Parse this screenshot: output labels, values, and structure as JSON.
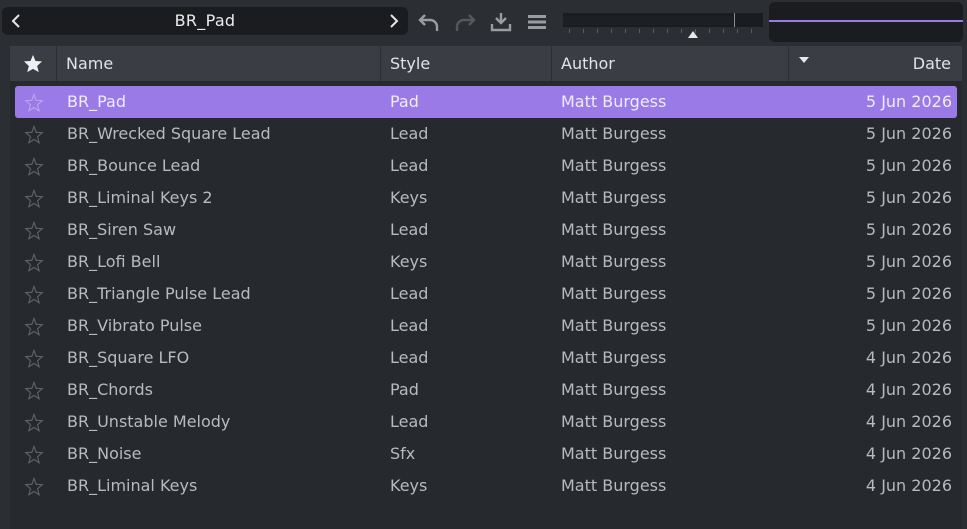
{
  "browser": {
    "current_preset": "BR_Pad",
    "prev_icon": "chevron-left-icon",
    "next_icon": "chevron-right-icon"
  },
  "toolbar": {
    "icons": [
      "undo-icon",
      "redo-icon",
      "save-icon",
      "menu-icon"
    ]
  },
  "colors": {
    "accent": "#9a7ae6",
    "header_bg": "#3a3d43",
    "panel_bg": "#26292d"
  },
  "table": {
    "columns": [
      "Name",
      "Style",
      "Author",
      "Date"
    ],
    "sort_column": "Date",
    "rows": [
      {
        "name": "BR_Pad",
        "style": "Pad",
        "author": "Matt Burgess",
        "date": "5 Jun 2026",
        "selected": true
      },
      {
        "name": "BR_Wrecked Square Lead",
        "style": "Lead",
        "author": "Matt Burgess",
        "date": "5 Jun 2026"
      },
      {
        "name": "BR_Bounce Lead",
        "style": "Lead",
        "author": "Matt Burgess",
        "date": "5 Jun 2026"
      },
      {
        "name": "BR_Liminal Keys 2",
        "style": "Keys",
        "author": "Matt Burgess",
        "date": "5 Jun 2026"
      },
      {
        "name": "BR_Siren Saw",
        "style": "Lead",
        "author": "Matt Burgess",
        "date": "5 Jun 2026"
      },
      {
        "name": "BR_Lofi Bell",
        "style": "Keys",
        "author": "Matt Burgess",
        "date": "5 Jun 2026"
      },
      {
        "name": "BR_Triangle Pulse Lead",
        "style": "Lead",
        "author": "Matt Burgess",
        "date": "5 Jun 2026"
      },
      {
        "name": "BR_Vibrato Pulse",
        "style": "Lead",
        "author": "Matt Burgess",
        "date": "5 Jun 2026"
      },
      {
        "name": "BR_Square LFO",
        "style": "Lead",
        "author": "Matt Burgess",
        "date": "4 Jun 2026"
      },
      {
        "name": "BR_Chords",
        "style": "Pad",
        "author": "Matt Burgess",
        "date": "4 Jun 2026"
      },
      {
        "name": "BR_Unstable Melody",
        "style": "Lead",
        "author": "Matt Burgess",
        "date": "4 Jun 2026"
      },
      {
        "name": "BR_Noise",
        "style": "Sfx",
        "author": "Matt Burgess",
        "date": "4 Jun 2026"
      },
      {
        "name": "BR_Liminal Keys",
        "style": "Keys",
        "author": "Matt Burgess",
        "date": "4 Jun 2026"
      }
    ]
  }
}
